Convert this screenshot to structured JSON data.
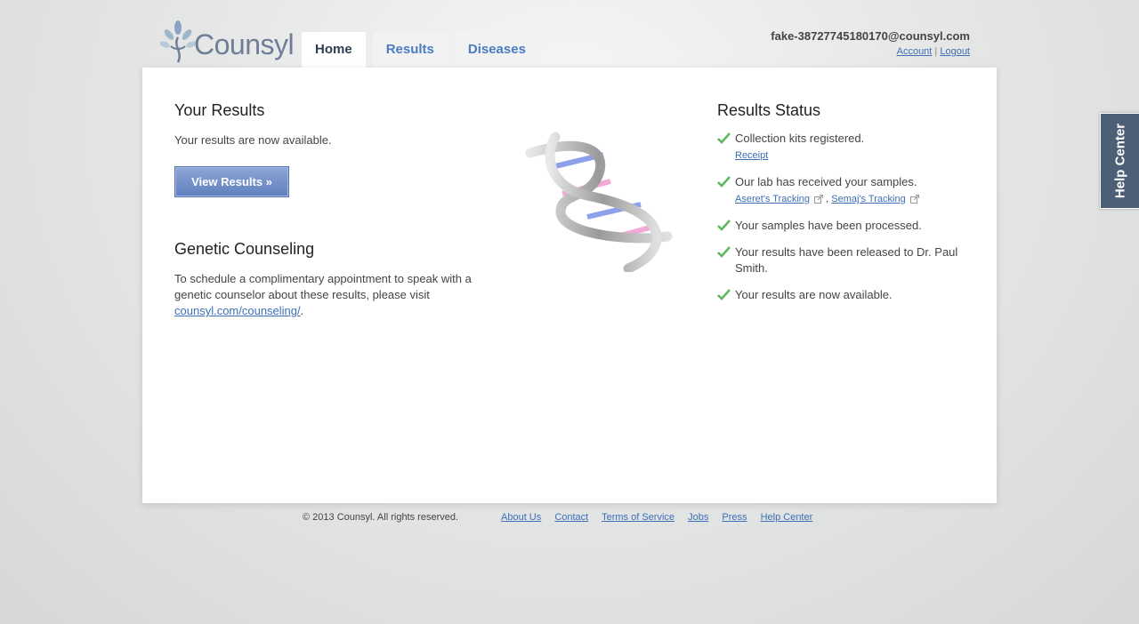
{
  "header": {
    "logo_text": "Counsyl",
    "tabs": [
      {
        "label": "Home",
        "active": true
      },
      {
        "label": "Results",
        "active": false
      },
      {
        "label": "Diseases",
        "active": false
      }
    ],
    "user_email": "fake-38727745180170@counsyl.com",
    "account_label": "Account",
    "separator": "|",
    "logout_label": "Logout"
  },
  "your_results": {
    "title": "Your Results",
    "text": "Your results are now available.",
    "button_label": "View Results »"
  },
  "genetic_counseling": {
    "title": "Genetic Counseling",
    "text": "To schedule a complimentary appointment to speak with a genetic counselor about these results, please visit",
    "link_label": "counsyl.com/counseling/",
    "trailing": "."
  },
  "results_status": {
    "title": "Results Status",
    "items": [
      {
        "text": "Collection kits registered.",
        "link": "Receipt"
      },
      {
        "text": "Our lab has received your samples.",
        "link1": "Aseret's Tracking",
        "comma": ",",
        "link2": "Semaj's Tracking"
      },
      {
        "text": "Your samples have been processed."
      },
      {
        "text": "Your results have been released to Dr. Paul Smith."
      },
      {
        "text": "Your results are now available."
      }
    ]
  },
  "help_center": {
    "label": "Help Center"
  },
  "footer": {
    "copyright": "© 2013 Counsyl. All rights reserved.",
    "links": [
      "About Us",
      "Contact",
      "Terms of Service",
      "Jobs",
      "Press",
      "Help Center"
    ]
  },
  "colors": {
    "accent": "#3d6fb6",
    "check": "#5cb85c",
    "help_bg": "#4d5e77"
  },
  "icons": [
    "logo-icon",
    "dna-image",
    "check-icon",
    "external-link-icon"
  ]
}
